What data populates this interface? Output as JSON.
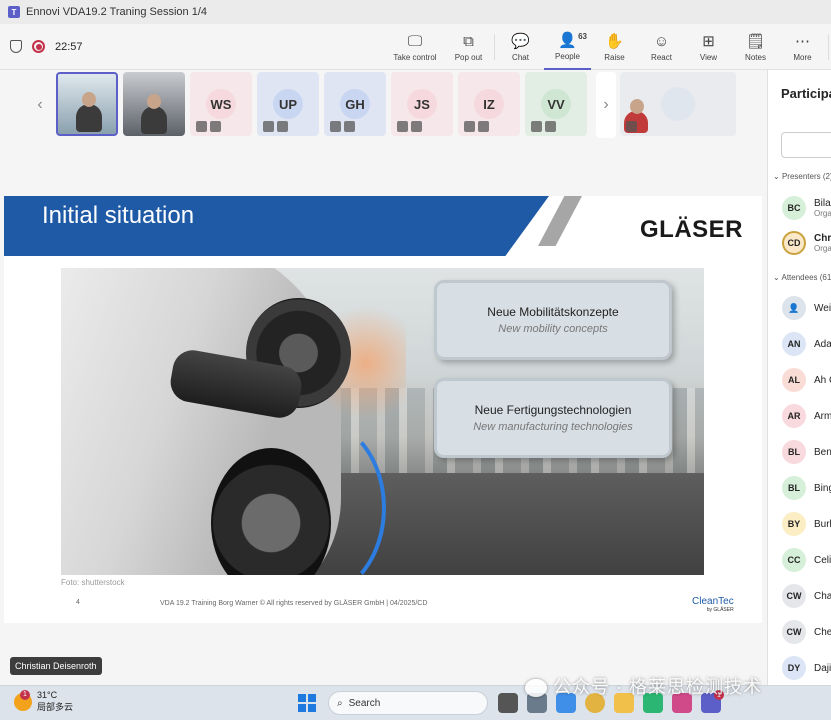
{
  "window": {
    "title": "Ennovi VDA19.2 Traning Session 1/4"
  },
  "meeting": {
    "timer": "22:57"
  },
  "toolbar": {
    "take_control": "Take control",
    "pop_out": "Pop out",
    "chat": "Chat",
    "people": "People",
    "people_count": "63",
    "raise": "Raise",
    "react": "React",
    "view": "View",
    "notes": "Notes",
    "more": "More"
  },
  "strip": {
    "tiles": [
      {
        "initials": "WS",
        "color": "#f6d9df"
      },
      {
        "initials": "UP",
        "color": "#c9d6f2"
      },
      {
        "initials": "GH",
        "color": "#c9d6f2"
      },
      {
        "initials": "JS",
        "color": "#f6d9df"
      },
      {
        "initials": "IZ",
        "color": "#f6d9df"
      },
      {
        "initials": "VV",
        "color": "#cfe7d2"
      }
    ]
  },
  "slide": {
    "title": "Initial situation",
    "logo": "GLÄSER",
    "box1": {
      "de": "Neue Mobilitätskonzepte",
      "en": "New mobility concepts"
    },
    "box2": {
      "de": "Neue Fertigungstechnologien",
      "en": "New manufacturing technologies"
    },
    "photo_credit": "Foto: shutterstock",
    "page": "4",
    "footer": "VDA 19.2 Training Borg Warner © All rights reserved by GLÄSER GmbH  | 04/2025/CD",
    "cleantec": "CleanTec",
    "cleantec_by": "by GLÄSER"
  },
  "speaker": {
    "name": "Christian Deisenroth"
  },
  "panel": {
    "title": "Participants",
    "presenters_label": "Presenters (2)",
    "attendees_label": "Attendees (61)",
    "presenters": [
      {
        "initials": "BC",
        "name": "Bila",
        "role": "Orga",
        "color": "#d6efd8"
      },
      {
        "initials": "CD",
        "name": "Chri",
        "role": "Orga",
        "color": "#fbe8c8"
      }
    ],
    "attendees": [
      {
        "initials": "",
        "name": "Wei",
        "color": "#dde3ea"
      },
      {
        "initials": "AN",
        "name": "Ada",
        "color": "#dbe5f5"
      },
      {
        "initials": "AL",
        "name": "Ah C",
        "color": "#fadcd6"
      },
      {
        "initials": "AR",
        "name": "Arm",
        "color": "#f8d9de"
      },
      {
        "initials": "BL",
        "name": "Ben",
        "color": "#f8d9de"
      },
      {
        "initials": "BL",
        "name": "Bing",
        "color": "#d6efd8"
      },
      {
        "initials": "BY",
        "name": "Burk",
        "color": "#fbeec4"
      },
      {
        "initials": "CC",
        "name": "Celi",
        "color": "#d6efd8"
      },
      {
        "initials": "CW",
        "name": "Cha",
        "color": "#e4e6ea"
      },
      {
        "initials": "CW",
        "name": "Che",
        "color": "#e4e6ea"
      },
      {
        "initials": "DY",
        "name": "Daji",
        "color": "#dbe5f5"
      }
    ]
  },
  "taskbar": {
    "temp": "31°C",
    "weather": "局部多云",
    "search": "Search",
    "watermark": "公众号 · 格莱思检测技术"
  }
}
